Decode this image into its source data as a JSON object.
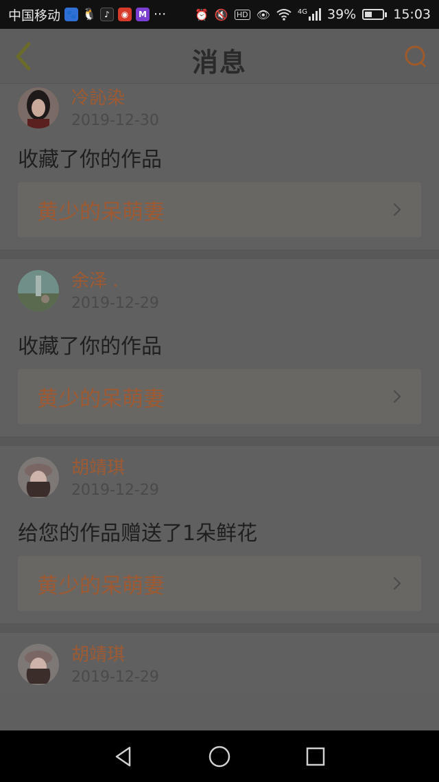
{
  "status_bar": {
    "carrier": "中国移动",
    "more": "···",
    "network": "4G",
    "battery_percent": "39%",
    "battery_level": 0.39,
    "time": "15:03",
    "app_icons": [
      "baidu-icon",
      "qq-icon",
      "tiktok-icon",
      "weibo-icon",
      "m-app-icon"
    ],
    "status_icons": [
      "alarm-icon",
      "mute-icon",
      "hd-icon",
      "eye-icon",
      "wifi-icon",
      "signal-icon"
    ]
  },
  "header": {
    "title": "消息",
    "back_icon": "chevron-left-icon",
    "search_icon": "search-icon",
    "accent_color": "#b5651d"
  },
  "messages": [
    {
      "user": "冷訫染",
      "date": "2019-12-30",
      "action": "收藏了你的作品",
      "work": "黄少的呆萌妻"
    },
    {
      "user": "余泽 .",
      "date": "2019-12-29",
      "action": "收藏了你的作品",
      "work": "黄少的呆萌妻"
    },
    {
      "user": "胡靖琪",
      "date": "2019-12-29",
      "action": "给您的作品赠送了1朵鲜花",
      "work": "黄少的呆萌妻"
    },
    {
      "user": "胡靖琪",
      "date": "2019-12-29",
      "action": "",
      "work": ""
    }
  ],
  "nav_bar": {
    "buttons": [
      "back-triangle-icon",
      "home-circle-icon",
      "recents-square-icon"
    ]
  }
}
